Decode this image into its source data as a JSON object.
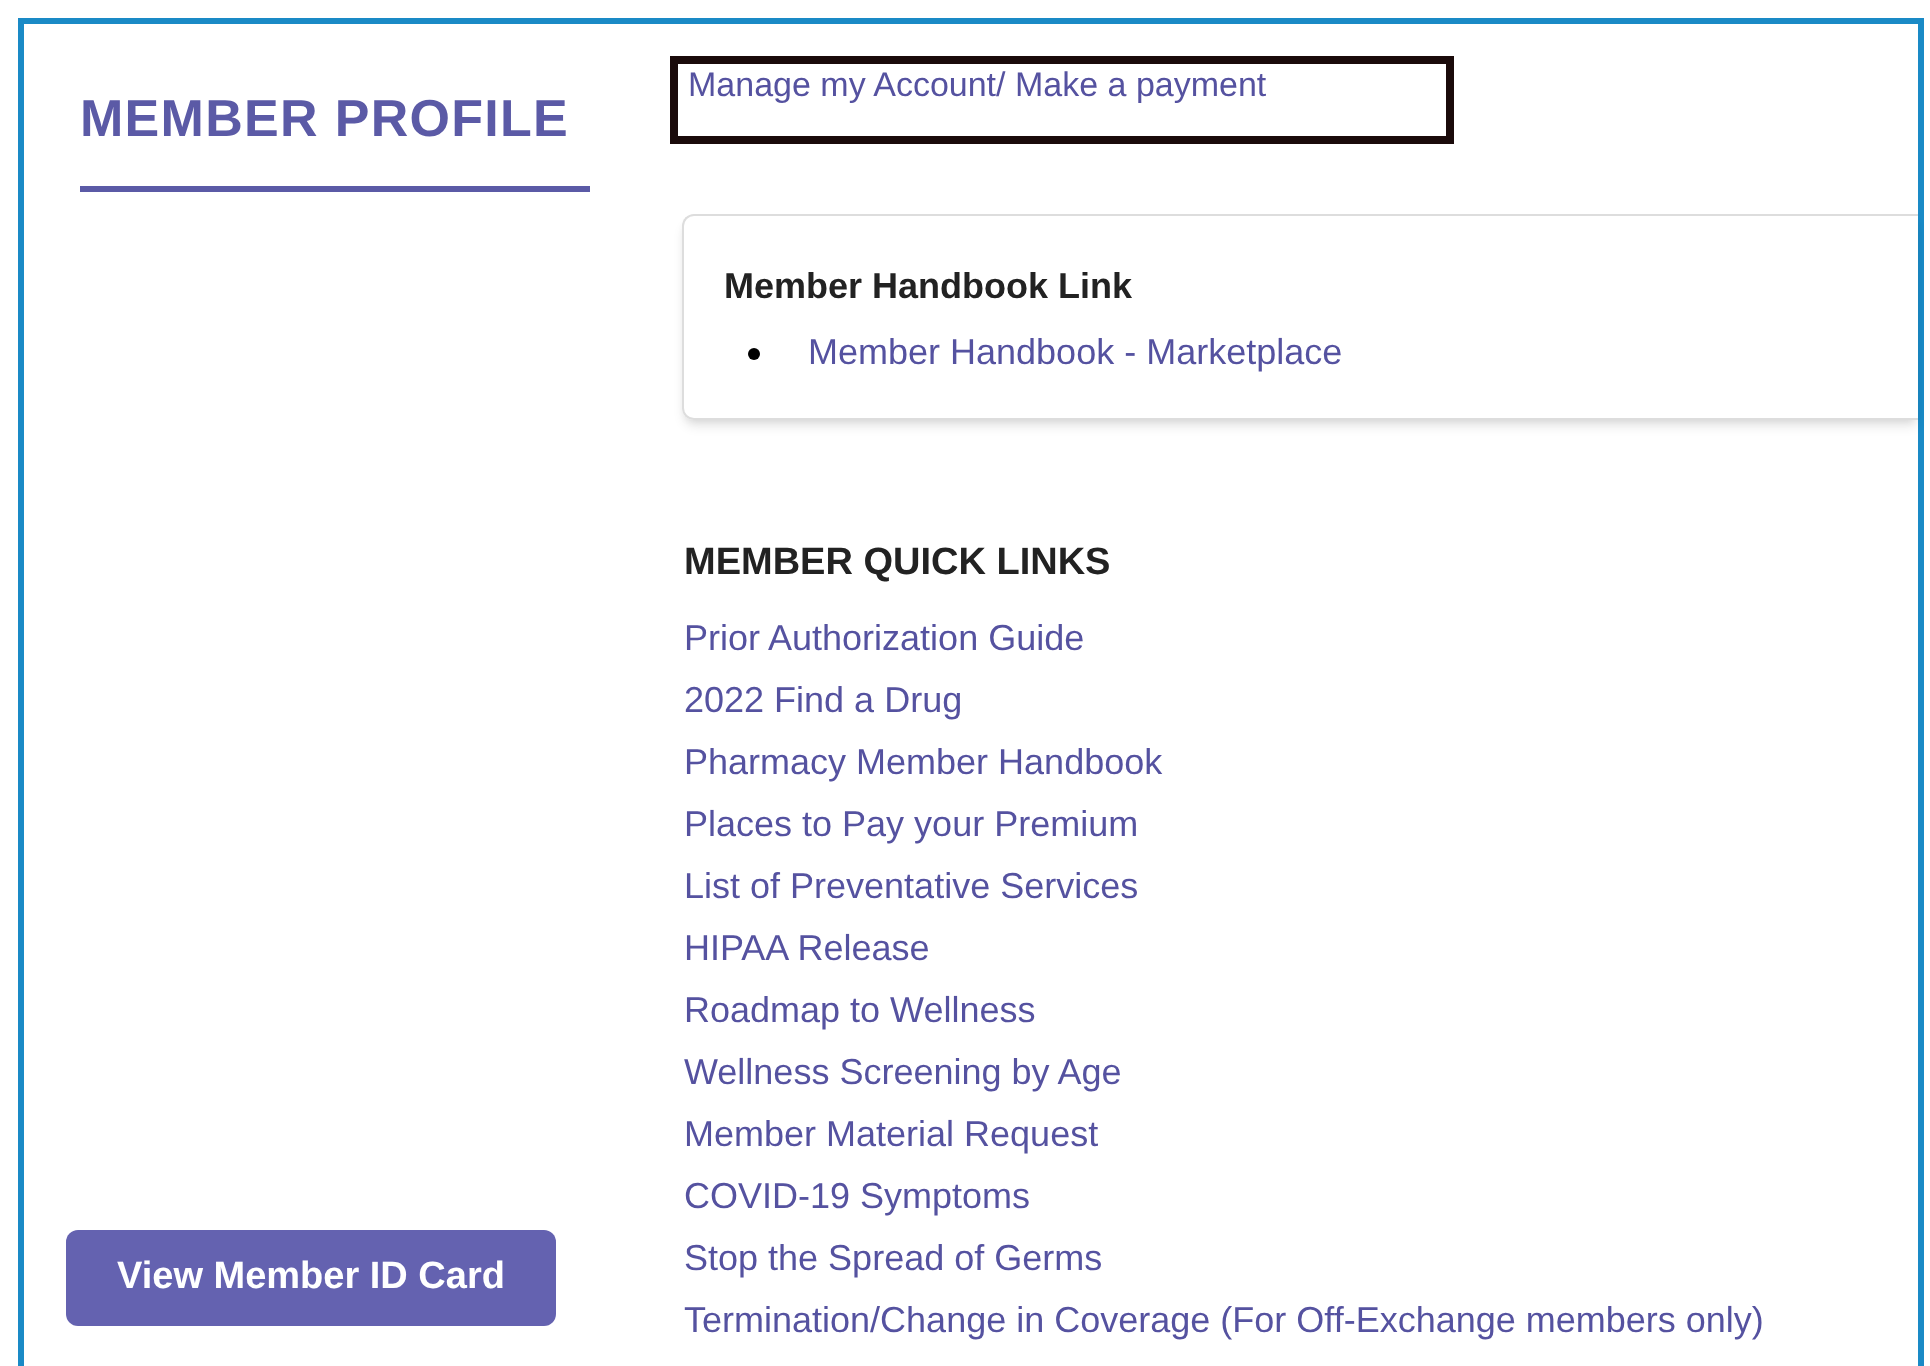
{
  "sidebar": {
    "title": "MEMBER PROFILE",
    "button": "View Member ID Card"
  },
  "account_link": {
    "label": "Manage my Account/ Make a payment",
    "highlighted": true
  },
  "handbook_card": {
    "title": "Member Handbook Link",
    "links": [
      "Member Handbook - Marketplace"
    ]
  },
  "quick_links": {
    "title": "MEMBER QUICK LINKS",
    "links": [
      "Prior Authorization Guide",
      "2022 Find a Drug",
      "Pharmacy Member Handbook",
      "Places to Pay your Premium",
      "List of Preventative Services",
      "HIPAA Release",
      "Roadmap to Wellness",
      "Wellness Screening by Age",
      "Member Material Request",
      "COVID-19 Symptoms",
      "Stop the Spread of Germs",
      "Termination/Change in Coverage (For Off-Exchange members only)"
    ]
  }
}
